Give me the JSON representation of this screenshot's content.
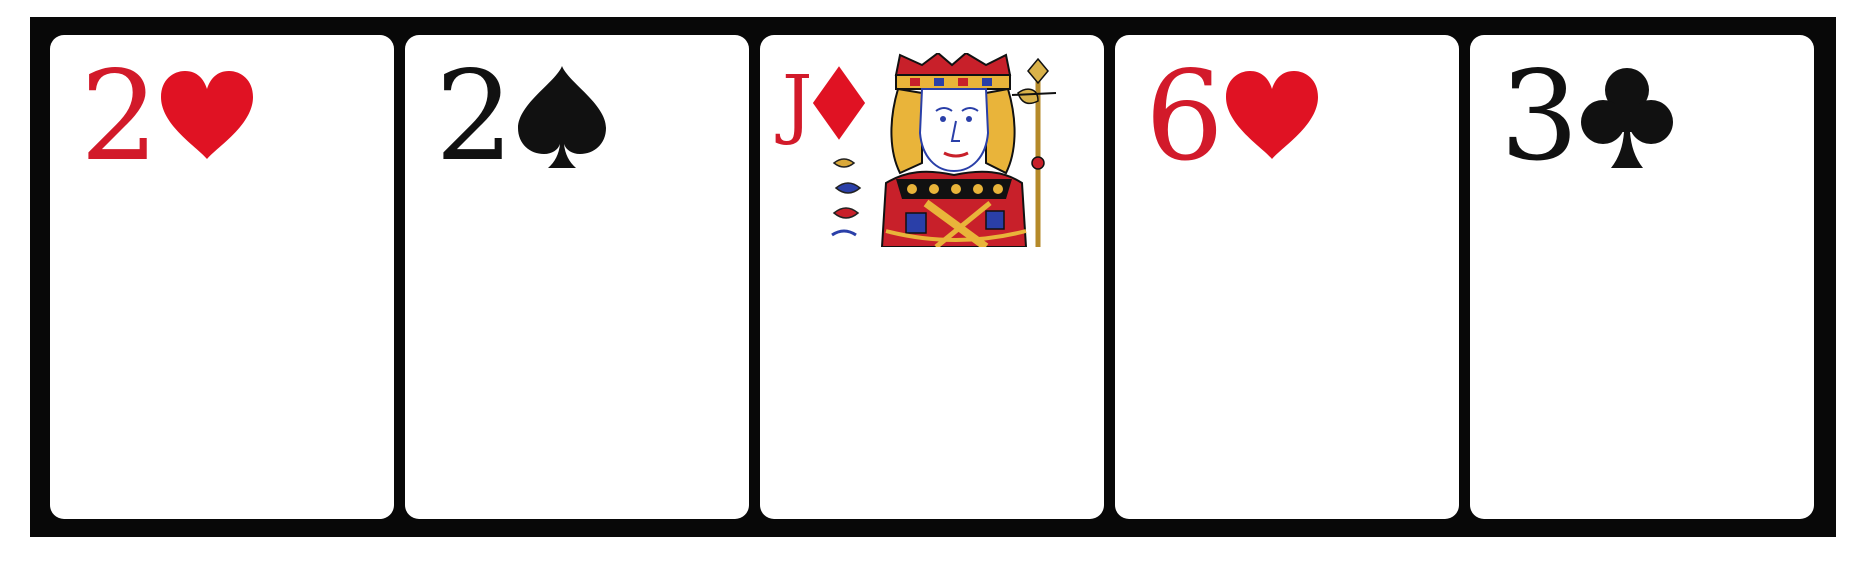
{
  "cards": [
    {
      "rank": "2",
      "suit": "hearts",
      "suit_icon": "heart-icon",
      "color": "#e01223"
    },
    {
      "rank": "2",
      "suit": "spades",
      "suit_icon": "spade-icon",
      "color": "#111111"
    },
    {
      "rank": "J",
      "suit": "diamonds",
      "suit_icon": "diamond-icon",
      "color": "#e01223",
      "face_art": "jack-portrait"
    },
    {
      "rank": "6",
      "suit": "hearts",
      "suit_icon": "heart-icon",
      "color": "#e01223"
    },
    {
      "rank": "3",
      "suit": "clubs",
      "suit_icon": "club-icon",
      "color": "#111111"
    }
  ],
  "colors": {
    "board": "#080808",
    "card": "#ffffff",
    "red_suit": "#e01223",
    "black_suit": "#111111"
  }
}
